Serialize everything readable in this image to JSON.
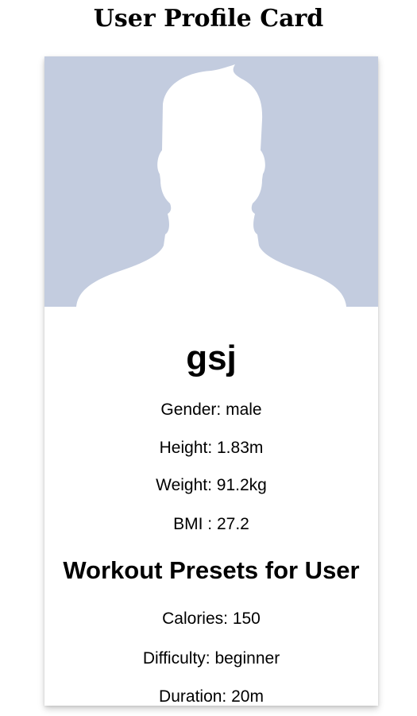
{
  "page": {
    "title": "User Profile Card"
  },
  "profile": {
    "username": "gsj",
    "gender": "Gender: male",
    "height": "Height: 1.83m",
    "weight": "Weight: 91.2kg",
    "bmi": "BMI : 27.2"
  },
  "workout": {
    "heading": "Workout Presets for User",
    "calories": "Calories: 150",
    "difficulty": "Difficulty: beginner",
    "duration": "Duration: 20m"
  },
  "icons": {
    "avatar": "default-user-silhouette-icon"
  },
  "colors": {
    "avatar_background": "#c3ccdf",
    "avatar_silhouette": "#ffffff"
  }
}
